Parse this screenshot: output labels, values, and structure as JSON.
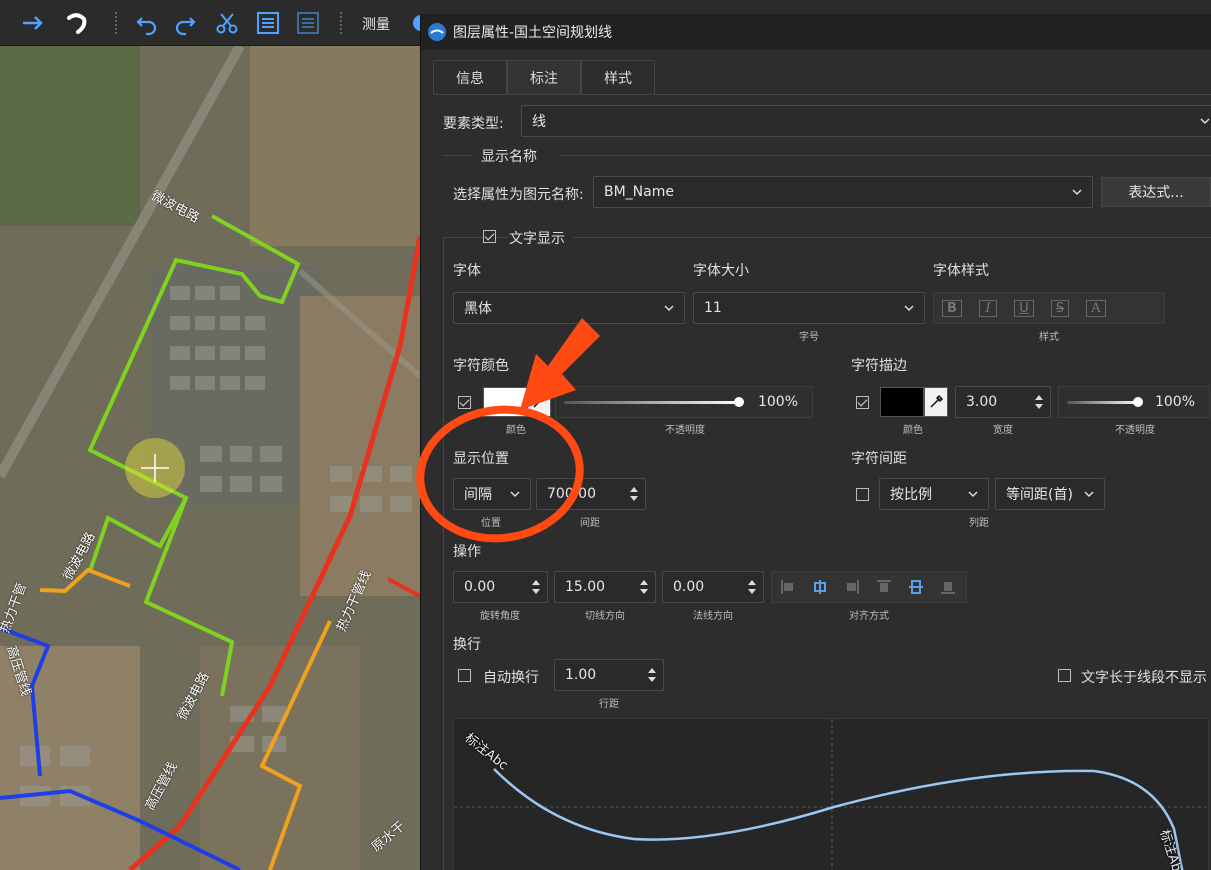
{
  "toolbar": {
    "measure_label": "测量",
    "icons": [
      "arrow-right-icon",
      "pan-hand-icon",
      "undo-icon",
      "redo-icon",
      "scissors-icon",
      "list-icon",
      "list-disabled-icon",
      "globe-icon"
    ]
  },
  "map": {
    "labels": {
      "microwave_top": "微波电路",
      "microwave_left": "微波电路",
      "microwave_bottom": "微波电路",
      "heat_pipe_left": "热力干管",
      "heat_pipe_right": "热力干管线",
      "hv_pipe_left": "高压管线",
      "hv_pipe_bottom": "高压管线",
      "raw_water": "原水干"
    },
    "colors": {
      "red_line": "#e8321e",
      "green_line": "#7fd21f",
      "orange_line": "#f0a21c",
      "blue_line": "#1e3fe6"
    }
  },
  "dialog": {
    "title": "图层属性-国土空间规划线",
    "tabs": [
      "信息",
      "标注",
      "样式"
    ],
    "active_tab": "标注",
    "element_type_label": "要素类型:",
    "element_type_value": "线",
    "display_name_group": "显示名称",
    "select_attr_label": "选择属性为图元名称:",
    "select_attr_value": "BM_Name",
    "expression_button": "表达式...",
    "text_display_label": "文字显示",
    "text_display_checked": true,
    "font_label": "字体",
    "font_value": "黑体",
    "font_size_label": "字体大小",
    "font_size_value": "11",
    "font_size_sub": "字号",
    "font_style_label": "字体样式",
    "font_style_sub": "样式",
    "font_style_buttons": [
      "B",
      "I",
      "U",
      "S",
      "A"
    ],
    "char_color_label": "字符颜色",
    "char_color_checked": true,
    "char_color_value": "#ffffff",
    "char_color_sub": "颜色",
    "char_opacity": "100%",
    "char_opacity_sub": "不透明度",
    "char_stroke_label": "字符描边",
    "char_stroke_checked": true,
    "stroke_color_value": "#000000",
    "stroke_color_sub": "颜色",
    "stroke_width": "3.00",
    "stroke_width_sub": "宽度",
    "stroke_opacity": "100%",
    "stroke_opacity_sub": "不透明度",
    "position_label": "显示位置",
    "position_value": "间隔",
    "position_sub": "位置",
    "spacing_value": "700.00",
    "spacing_sub": "间距",
    "char_spacing_label": "字符间距",
    "char_spacing_checked": false,
    "ratio_value": "按比例",
    "equal_spacing_value": "等间距(首)",
    "column_spacing_sub": "列距",
    "operation_label": "操作",
    "rotation_value": "0.00",
    "rotation_sub": "旋转角度",
    "tangent_value": "15.00",
    "tangent_sub": "切线方向",
    "normal_value": "0.00",
    "normal_sub": "法线方向",
    "align_sub": "对齐方式",
    "wrap_label": "换行",
    "auto_wrap_label": "自动换行",
    "auto_wrap_checked": false,
    "line_spacing_value": "1.00",
    "line_spacing_sub": "行距",
    "hide_long_label": "文字长于线段不显示",
    "hide_long_checked": false,
    "preview_label_start": "标注Abc",
    "preview_label_end": "标注Abc"
  },
  "annotation": {
    "arrow_color": "#ff4a14",
    "circle_color": "#ff4a14"
  }
}
